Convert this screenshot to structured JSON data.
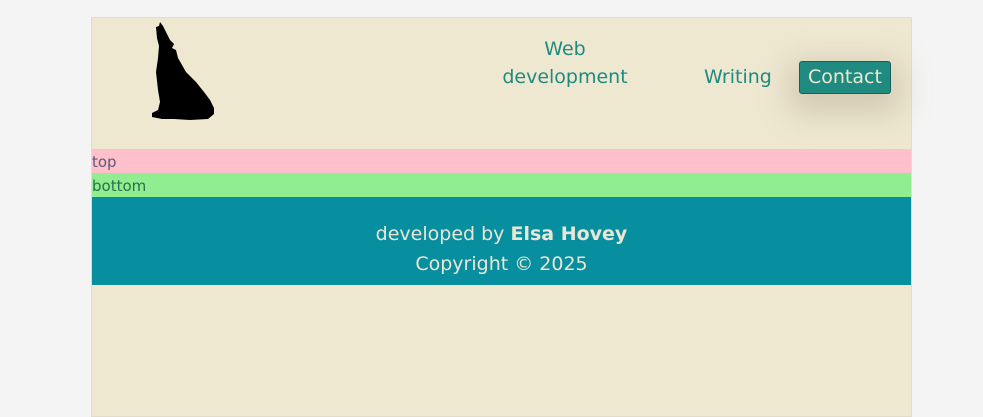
{
  "nav": {
    "web_development": "Web development",
    "writing": "Writing",
    "contact": "Contact"
  },
  "sections": {
    "top": "top",
    "bottom": "bottom"
  },
  "footer": {
    "developed_by": "developed by",
    "author": "Elsa Hovey",
    "copyright": "Copyright © 2025"
  },
  "colors": {
    "accent": "#1e8a80",
    "footer": "#088f9f",
    "top_bar": "#ffc0cb",
    "bottom_bar": "#90ee90",
    "background": "#efe8d1"
  },
  "logo": {
    "icon": "howling-wolf-icon"
  }
}
